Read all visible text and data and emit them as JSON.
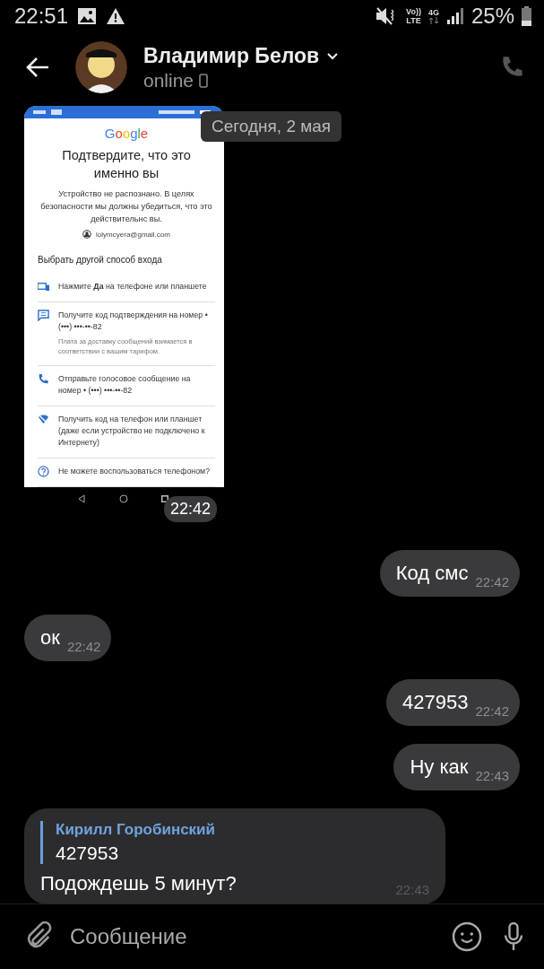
{
  "status_bar": {
    "time": "22:51",
    "volte_top": "Vo))",
    "volte_bottom": "LTE",
    "network": "4G",
    "battery": "25%"
  },
  "header": {
    "name": "Владимир Белов",
    "status": "online"
  },
  "date_chip": "Сегодня, 2 мая",
  "messages": [
    {
      "kind": "image",
      "outgoing": false,
      "time": "22:42",
      "screen": {
        "logo": "Google",
        "title": "Подтвердите, что это именно вы",
        "description": "Устройство не распознано. В целях безопасности мы должны убедиться, что это действительнс вы.",
        "email": "lolymcyera@gmail.com",
        "section_title": "Выбрать другой способ входа",
        "options": [
          {
            "kind": "device",
            "text": "Нажмите **Да** на телефоне или планшете"
          },
          {
            "kind": "sms",
            "text": "Получите код подтверждения на номер • (•••) •••-••-82",
            "note": "Плата за доставку сообщений взимается в соответствии с вашим тарифом."
          },
          {
            "kind": "call",
            "text": "Отправьте голосовое сообщение на номер • (•••) •••-••-82"
          },
          {
            "kind": "offline",
            "text": "Получить код на телефон или планшет (даже если устройство не подключено к Интернету)"
          },
          {
            "kind": "help",
            "text": "Не можете воспользоваться телефоном?"
          }
        ]
      }
    },
    {
      "kind": "text",
      "outgoing": true,
      "text": "Код смс",
      "time": "22:42"
    },
    {
      "kind": "text",
      "outgoing": false,
      "text": "ок",
      "time": "22:42"
    },
    {
      "kind": "text",
      "outgoing": true,
      "text": "427953",
      "time": "22:42"
    },
    {
      "kind": "text",
      "outgoing": true,
      "text": "Ну как",
      "time": "22:43"
    },
    {
      "kind": "reply",
      "reply_author": "Кирилл Горобинский",
      "reply_text": "427953",
      "text": "Подождешь 5 минут?",
      "time": "22:43"
    }
  ],
  "composer": {
    "placeholder": "Сообщение"
  }
}
